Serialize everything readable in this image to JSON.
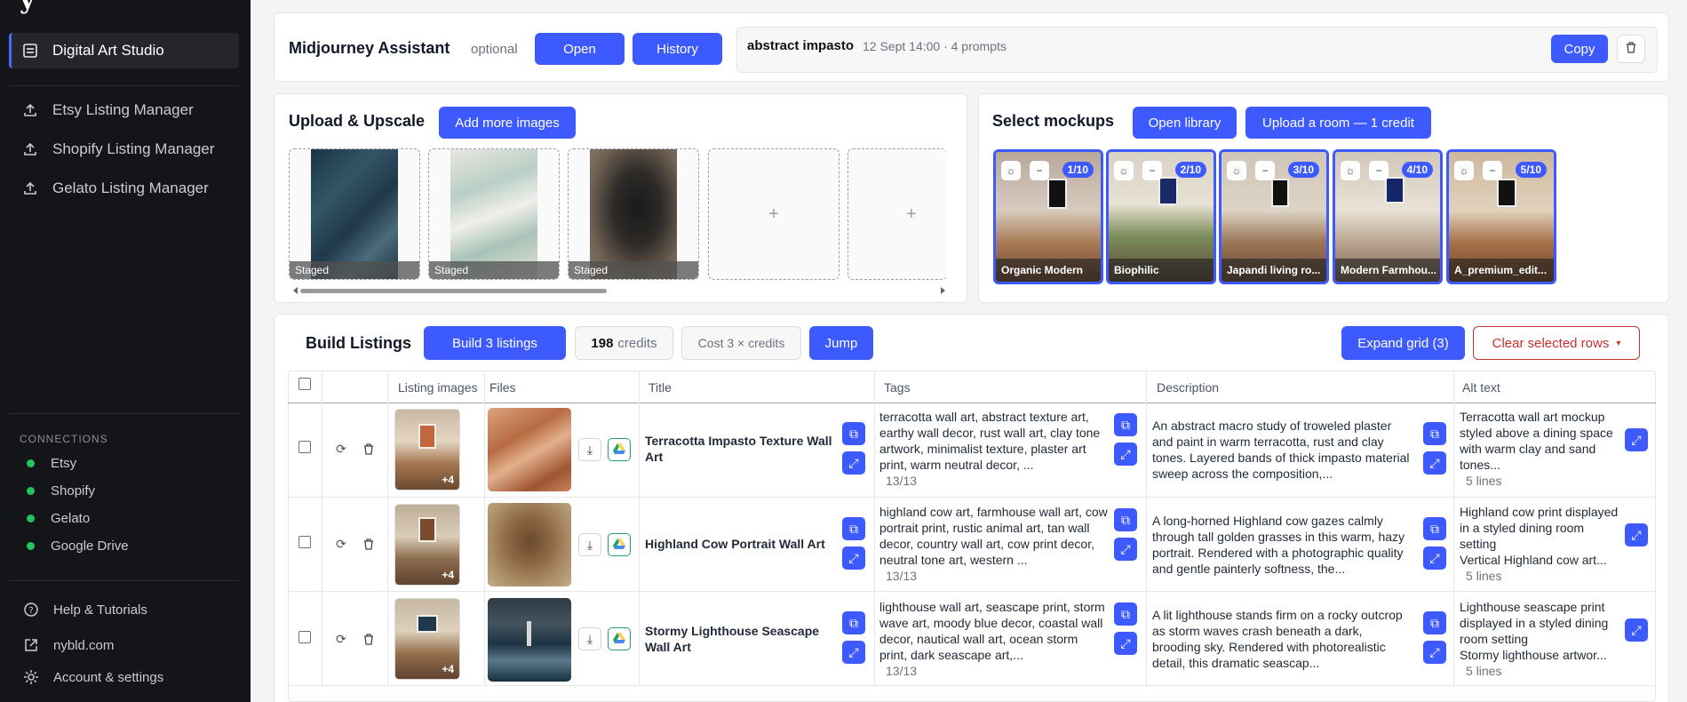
{
  "sidebar": {
    "logo_fragment": "y",
    "active_item": "Digital Art Studio",
    "items": [
      "Etsy Listing Manager",
      "Shopify Listing Manager",
      "Gelato Listing Manager"
    ],
    "connections_title": "CONNECTIONS",
    "connections": [
      "Etsy",
      "Shopify",
      "Gelato",
      "Google Drive"
    ],
    "bottom": [
      "Help & Tutorials",
      "nybld.com",
      "Account & settings"
    ],
    "status_color": "#22c55e"
  },
  "assistant": {
    "title": "Midjourney Assistant",
    "optional": "optional",
    "open": "Open",
    "history": "History",
    "prompt_name": "abstract impasto",
    "prompt_meta": "12 Sept 14:00 · 4 prompts",
    "copy": "Copy",
    "delete_icon": "trash-icon"
  },
  "upload": {
    "title": "Upload & Upscale",
    "add_more": "Add more images",
    "staged_label": "Staged",
    "plus": "+",
    "slots": [
      "staged",
      "staged",
      "staged",
      "empty",
      "empty"
    ]
  },
  "mockups": {
    "title": "Select mockups",
    "open_library": "Open library",
    "upload_room": "Upload a room — 1 credit",
    "items": [
      {
        "name": "Organic Modern",
        "count": "1/10"
      },
      {
        "name": "Biophilic",
        "count": "2/10"
      },
      {
        "name": "Japandi living ro...",
        "count": "3/10"
      },
      {
        "name": "Modern Farmhou...",
        "count": "4/10"
      },
      {
        "name": "A_premium_edit...",
        "count": "5/10"
      }
    ]
  },
  "build": {
    "title": "Build Listings",
    "build_btn": "Build 3 listings",
    "credits_value": "198",
    "credits_label": "credits",
    "cost": "Cost 3 × credits",
    "jump": "Jump",
    "expand": "Expand grid (3)",
    "clear": "Clear selected rows",
    "clear_caret": "▾"
  },
  "table": {
    "columns": [
      "Listing images",
      "Files",
      "Title",
      "Tags",
      "Description",
      "Alt text"
    ],
    "rows": [
      {
        "thumb_more": "+4",
        "title": "Terracotta Impasto Texture Wall Art",
        "tags": "terracotta wall art, abstract texture art, earthy wall decor, rust wall art, clay tone artwork, minimalist texture, plaster art print, warm neutral decor, ...",
        "tags_count": "13/13",
        "description": "An abstract macro study of troweled plaster and paint in warm terracotta, rust and clay tones. Layered bands of thick impasto material sweep across the composition,...",
        "alt": "Terracotta wall art mockup styled above a dining space with warm clay and sand tones...",
        "alt_lines": "5 lines"
      },
      {
        "thumb_more": "+4",
        "title": "Highland Cow Portrait Wall Art",
        "tags": "highland cow art, farmhouse wall art, cow portrait print, rustic animal art, tan wall decor, country wall art, cow print decor, neutral tone art, western ...",
        "tags_count": "13/13",
        "description": "A long-horned Highland cow gazes calmly through tall golden grasses in this warm, hazy portrait. Rendered with a photographic quality and gentle painterly softness, the...",
        "alt": "Highland cow print displayed in a styled dining room setting\nVertical Highland cow art...",
        "alt_lines": "5 lines"
      },
      {
        "thumb_more": "+4",
        "title": "Stormy Lighthouse Seascape Wall Art",
        "tags": "lighthouse wall art, seascape print, storm wave art, moody blue decor, coastal wall decor, nautical wall art, ocean storm print, dark seascape art,...",
        "tags_count": "13/13",
        "description": "A lit lighthouse stands firm on a rocky outcrop as storm waves crash beneath a dark, brooding sky. Rendered with photorealistic detail, this dramatic seascap...",
        "alt": "Lighthouse seascape print displayed in a styled dining room setting\nStormy lighthouse artwor...",
        "alt_lines": "5 lines"
      }
    ]
  },
  "accent_color": "#3d5afe"
}
